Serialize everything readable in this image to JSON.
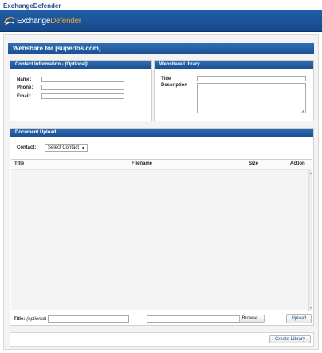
{
  "app": {
    "title": "ExchangeDefender"
  },
  "brand": {
    "logo_text_exchange": "Exchange",
    "logo_text_defender": "Defender",
    "accent": "#f0a23a",
    "bar_color": "#1f5fa8"
  },
  "main": {
    "heading": "Webshare for [superlos.com]"
  },
  "contact": {
    "heading": "Contact Information - ",
    "heading_note": "(Optional)",
    "name_label": "Name:",
    "phone_label": "Phone:",
    "email_label": "Email:",
    "name_value": "",
    "phone_value": "",
    "email_value": ""
  },
  "library": {
    "heading": "Webshare Library",
    "title_label": "Title",
    "description_label": "Description",
    "title_value": "",
    "description_value": ""
  },
  "upload": {
    "heading": "Document Upload",
    "contact_label": "Contact:",
    "contact_selected": "Select Contact",
    "columns": {
      "title": "Title",
      "filename": "Filename",
      "size": "Size",
      "action": "Action"
    },
    "rows": [],
    "title_label": "Title:",
    "title_note": "(optional)",
    "title_value": "",
    "file_value": "",
    "browse_label": "Browse...",
    "upload_label": "Upload"
  },
  "footer": {
    "create_label": "Create Library"
  }
}
